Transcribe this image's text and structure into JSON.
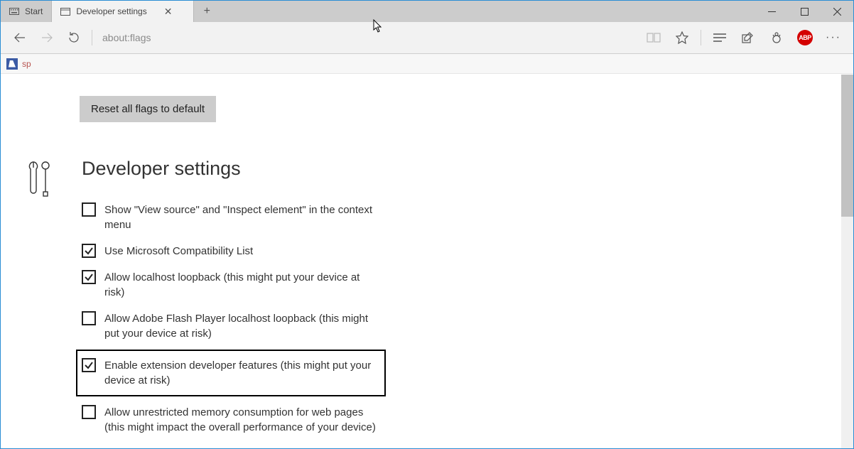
{
  "tabs": [
    {
      "label": "Start",
      "active": false
    },
    {
      "label": "Developer settings",
      "active": true
    }
  ],
  "address_bar": {
    "text": "about:flags"
  },
  "ext_bar": {
    "label": "sp"
  },
  "abp_label": "ABP",
  "page": {
    "reset_button": "Reset all flags to default",
    "heading": "Developer settings",
    "options": [
      {
        "label": "Show \"View source\" and \"Inspect element\" in the context menu",
        "checked": false,
        "highlighted": false
      },
      {
        "label": "Use Microsoft Compatibility List",
        "checked": true,
        "highlighted": false
      },
      {
        "label": "Allow localhost loopback (this might put your device at risk)",
        "checked": true,
        "highlighted": false
      },
      {
        "label": "Allow Adobe Flash Player localhost loopback (this might put your device at risk)",
        "checked": false,
        "highlighted": false
      },
      {
        "label": "Enable extension developer features (this might put your device at risk)",
        "checked": true,
        "highlighted": true
      },
      {
        "label": "Allow unrestricted memory consumption for web pages (this might impact the overall performance of your device)",
        "checked": false,
        "highlighted": false
      }
    ]
  }
}
